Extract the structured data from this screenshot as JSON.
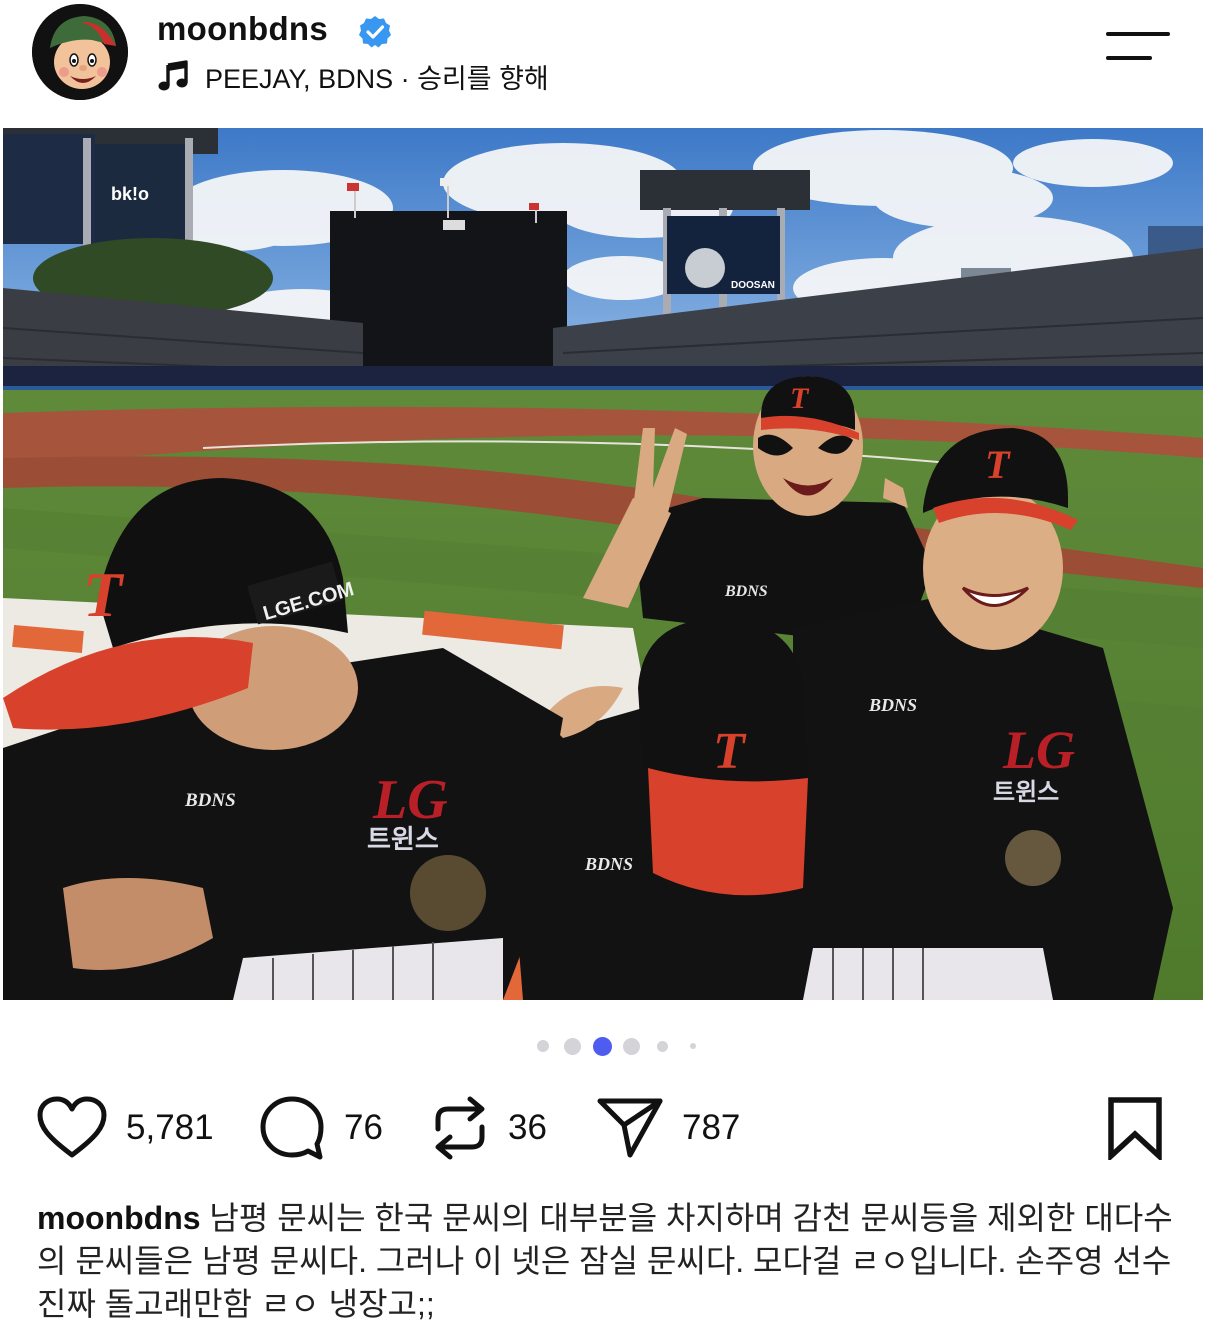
{
  "post": {
    "username": "moonbdns",
    "verified": true,
    "music": "PEEJAY, BDNS · 승리를 향해",
    "carousel": {
      "count": 6,
      "active_index": 2
    },
    "actions": {
      "likes": "5,781",
      "comments": "76",
      "reposts": "36",
      "shares": "787"
    },
    "caption_text": "남평 문씨는 한국 문씨의 대부분을 차지하며 감천 문씨등을 제외한 대다수의 문씨들은 남평 문씨다. 그러나 이 넷은 잠실 문씨다. 모다걸 ㄹㅇ입니다. 손주영 선수 진짜 돌고래만함 ㄹㅇ 냉장고;;"
  },
  "photo": {
    "cap_logo": "T",
    "jersey_text": "BDNS",
    "team_logo": "LG",
    "team_name": "트윈스",
    "cap_side_text": "LGE.COM",
    "scoreboard_sponsor": "DOOSAN",
    "left_board_text": "bk!o"
  },
  "colors": {
    "accent_blue": "#4f5cf0",
    "verified_blue": "#3897f0",
    "cap_red": "#d8412b"
  }
}
